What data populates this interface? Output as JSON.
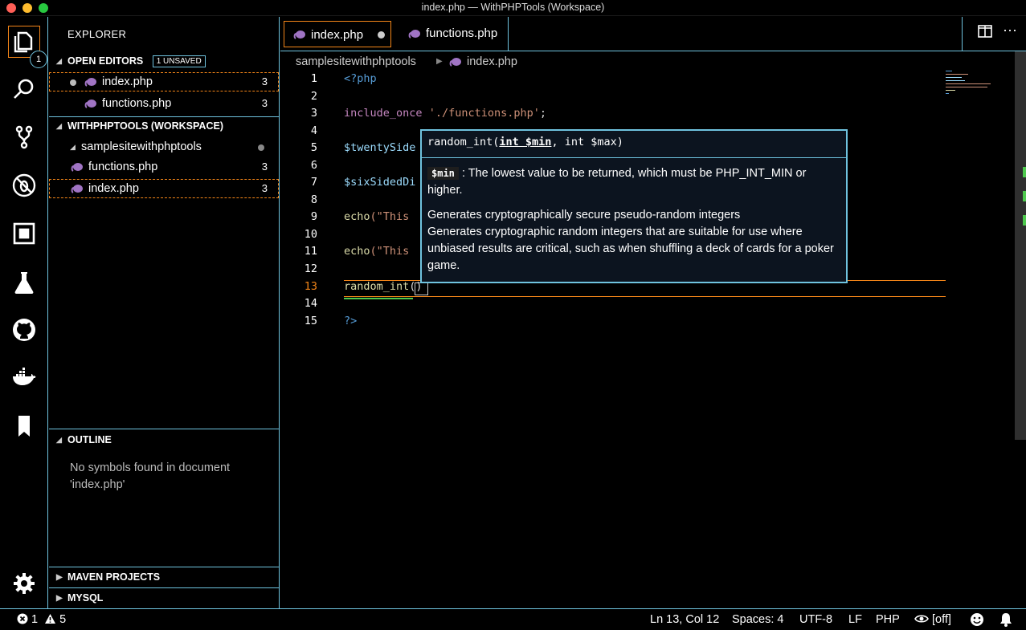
{
  "window": {
    "title": "index.php — WithPHPTools (Workspace)"
  },
  "activity": {
    "explorer_badge": "1",
    "items": [
      "files-icon",
      "search-icon",
      "source-control-icon",
      "debug-icon",
      "extensions-icon",
      "test-flask-icon",
      "github-icon",
      "docker-icon",
      "bookmark-icon",
      "settings-gear-icon"
    ]
  },
  "sidebar": {
    "title": "EXPLORER",
    "open_editors": {
      "header": "OPEN EDITORS",
      "unsaved": "1 UNSAVED",
      "items": [
        {
          "name": "index.php",
          "count": "3"
        },
        {
          "name": "functions.php",
          "count": "3"
        }
      ]
    },
    "workspace": {
      "header": "WITHPHPTOOLS (WORKSPACE)",
      "folder": "samplesitewithphptools",
      "files": [
        {
          "name": "functions.php",
          "count": "3"
        },
        {
          "name": "index.php",
          "count": "3"
        }
      ]
    },
    "outline": {
      "header": "OUTLINE",
      "empty_message": "No symbols found in document 'index.php'"
    },
    "maven": {
      "header": "MAVEN PROJECTS"
    },
    "mysql": {
      "header": "MYSQL"
    }
  },
  "tabs": [
    {
      "label": "index.php"
    },
    {
      "label": "functions.php"
    }
  ],
  "breadcrumb": {
    "folder": "samplesitewithphptools",
    "file": "index.php"
  },
  "editor": {
    "line_numbers": [
      "1",
      "2",
      "3",
      "4",
      "5",
      "6",
      "7",
      "8",
      "9",
      "10",
      "11",
      "12",
      "13",
      "14",
      "15"
    ],
    "current_line": "13",
    "lines": {
      "l1": "<?php",
      "l3_kw": "include_once",
      "l3_str": "'./functions.php'",
      "l3_end": ";",
      "l5": "$twentySide",
      "l7": "$sixSidedDi",
      "l9_fn": "echo",
      "l9_rest": "(\"This",
      "l11_fn": "echo",
      "l11_rest": "(\"This",
      "l13_fn": "random_int",
      "l13_rest": "()",
      "l15": "?>"
    }
  },
  "hover": {
    "sig_name": "random_int(",
    "sig_param1": "int $min",
    "sig_rest": ", int $max)",
    "param_name": "$min",
    "param_desc": ": The lowest value to be returned, which must be PHP_INT_MIN or higher.",
    "summary": "Generates cryptographically secure pseudo-random integers",
    "description": "Generates cryptographic random integers that are suitable for use where unbiased results are critical, such as when shuffling a deck of cards for a poker game."
  },
  "status": {
    "errors": "1",
    "warnings": "5",
    "position": "Ln 13, Col 12",
    "spaces": "Spaces: 4",
    "encoding": "UTF-8",
    "eol": "LF",
    "language": "PHP",
    "preview": "[off]"
  },
  "colors": {
    "accent_border": "#6fc3df",
    "focus_border": "#f38518",
    "php_icon": "#a074c4"
  }
}
